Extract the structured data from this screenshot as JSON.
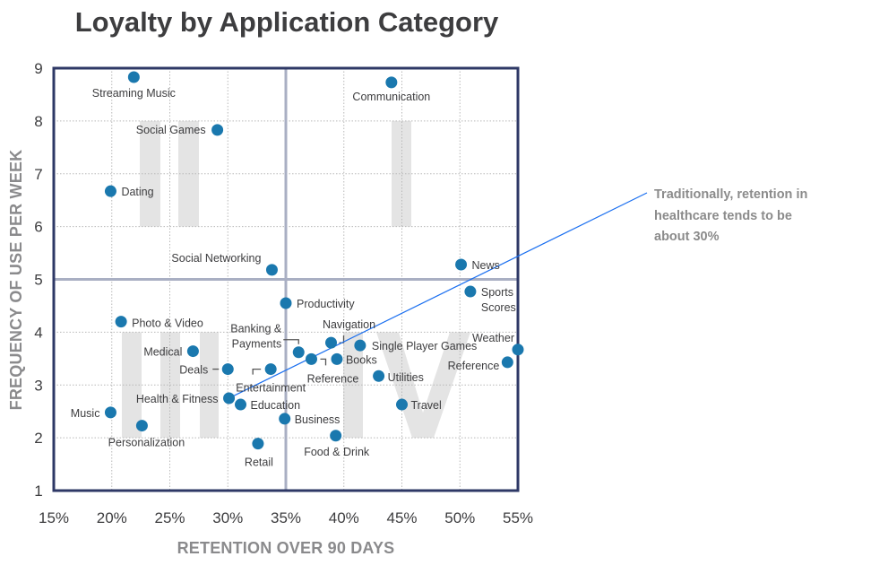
{
  "chart_data": {
    "type": "scatter",
    "title": "Loyalty by Application Category",
    "xlabel": "RETENTION OVER 90 DAYS",
    "ylabel": "FREQUENCY OF USE PER WEEK",
    "xlim": [
      15,
      55
    ],
    "ylim": [
      1,
      9
    ],
    "x_ticks": [
      15,
      20,
      25,
      30,
      35,
      40,
      45,
      50,
      55
    ],
    "x_tick_labels": [
      "15%",
      "20%",
      "25%",
      "30%",
      "35%",
      "40%",
      "45%",
      "50%",
      "55%"
    ],
    "y_ticks": [
      1,
      2,
      3,
      4,
      5,
      6,
      7,
      8,
      9
    ],
    "y_tick_labels": [
      "1",
      "2",
      "3",
      "4",
      "5",
      "6",
      "7",
      "8",
      "9"
    ],
    "grid": true,
    "quadrant_dividers": {
      "x": 35,
      "y": 5
    },
    "quadrant_labels": [
      {
        "label": "I",
        "quadrant": "top-right"
      },
      {
        "label": "II",
        "quadrant": "top-left"
      },
      {
        "label": "III",
        "quadrant": "bottom-left"
      },
      {
        "label": "IV",
        "quadrant": "bottom-right"
      }
    ],
    "point_color": "#1a78ae",
    "points": [
      {
        "name": "Streaming Music",
        "x": 21.9,
        "y": 8.83
      },
      {
        "name": "Communication",
        "x": 44.1,
        "y": 8.73
      },
      {
        "name": "Social Games",
        "x": 29.1,
        "y": 7.83
      },
      {
        "name": "Dating",
        "x": 19.9,
        "y": 6.67
      },
      {
        "name": "Social Networking",
        "x": 33.8,
        "y": 5.18
      },
      {
        "name": "News",
        "x": 50.1,
        "y": 5.28
      },
      {
        "name": "Sports Scores",
        "x": 50.9,
        "y": 4.77
      },
      {
        "name": "Productivity",
        "x": 35.0,
        "y": 4.55
      },
      {
        "name": "Photo & Video",
        "x": 20.8,
        "y": 4.2
      },
      {
        "name": "Medical",
        "x": 27.0,
        "y": 3.64
      },
      {
        "name": "Deals",
        "x": 30.0,
        "y": 3.3
      },
      {
        "name": "Entertainment",
        "x": 33.7,
        "y": 3.3
      },
      {
        "name": "Banking & Payments",
        "x": 36.1,
        "y": 3.62
      },
      {
        "name": "Reference",
        "x": 37.2,
        "y": 3.49
      },
      {
        "name": "Navigation",
        "x": 38.9,
        "y": 3.8
      },
      {
        "name": "Books",
        "x": 39.4,
        "y": 3.49
      },
      {
        "name": "Single Player Games",
        "x": 41.4,
        "y": 3.75
      },
      {
        "name": "Utilities",
        "x": 43.0,
        "y": 3.17
      },
      {
        "name": "Travel",
        "x": 45.0,
        "y": 2.63
      },
      {
        "name": "Weather",
        "x": 55.0,
        "y": 3.67
      },
      {
        "name": "Reference",
        "x": 54.1,
        "y": 3.43
      },
      {
        "name": "Health & Fitness",
        "x": 30.1,
        "y": 2.75
      },
      {
        "name": "Education",
        "x": 31.1,
        "y": 2.63
      },
      {
        "name": "Business",
        "x": 34.9,
        "y": 2.36
      },
      {
        "name": "Music",
        "x": 19.9,
        "y": 2.48
      },
      {
        "name": "Personalization",
        "x": 22.6,
        "y": 2.23
      },
      {
        "name": "Food & Drink",
        "x": 39.3,
        "y": 2.04
      },
      {
        "name": "Retail",
        "x": 32.6,
        "y": 1.89
      }
    ],
    "annotation": {
      "lines": [
        "Traditionally, retention in",
        "healthcare tends to be",
        "about 30%"
      ],
      "points_to": "Health & Fitness",
      "line_color": "#1a6ff0"
    }
  }
}
